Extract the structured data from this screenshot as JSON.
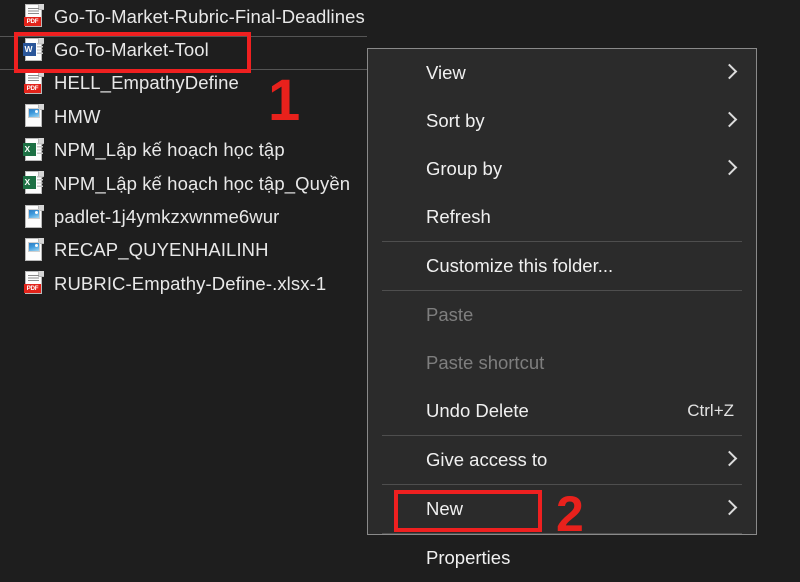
{
  "window": {
    "background_color": "#1e1e1e",
    "menu_background_color": "#2b2b2b",
    "annotation_color": "#e8211c"
  },
  "file_list": {
    "items": [
      {
        "name": "Go-To-Market-Rubric-Final-Deadlines",
        "icon": "pdf-file-icon",
        "type": "pdf"
      },
      {
        "name": "Go-To-Market-Tool",
        "icon": "word-file-icon",
        "type": "word"
      },
      {
        "name": "HELL_EmpathyDefine",
        "icon": "pdf-file-icon",
        "type": "pdf"
      },
      {
        "name": "HMW",
        "icon": "image-file-icon",
        "type": "image"
      },
      {
        "name": "NPM_Lập kế hoạch học tập",
        "icon": "excel-file-icon",
        "type": "excel"
      },
      {
        "name": "NPM_Lập kế hoạch học tập_Quyền",
        "icon": "excel-file-icon",
        "type": "excel"
      },
      {
        "name": "padlet-1j4ymkzxwnme6wur",
        "icon": "image-file-icon",
        "type": "image"
      },
      {
        "name": "RECAP_QUYENHAILINH",
        "icon": "image-file-icon",
        "type": "image"
      },
      {
        "name": "RUBRIC-Empathy-Define-.xlsx-1",
        "icon": "pdf-file-icon",
        "type": "pdf"
      }
    ]
  },
  "context_menu": {
    "groups": [
      {
        "items": [
          {
            "label": "View",
            "submenu": true,
            "disabled": false,
            "accel": ""
          },
          {
            "label": "Sort by",
            "submenu": true,
            "disabled": false,
            "accel": ""
          },
          {
            "label": "Group by",
            "submenu": true,
            "disabled": false,
            "accel": ""
          },
          {
            "label": "Refresh",
            "submenu": false,
            "disabled": false,
            "accel": ""
          }
        ]
      },
      {
        "items": [
          {
            "label": "Customize this folder...",
            "submenu": false,
            "disabled": false,
            "accel": ""
          }
        ]
      },
      {
        "items": [
          {
            "label": "Paste",
            "submenu": false,
            "disabled": true,
            "accel": ""
          },
          {
            "label": "Paste shortcut",
            "submenu": false,
            "disabled": true,
            "accel": ""
          },
          {
            "label": "Undo Delete",
            "submenu": false,
            "disabled": false,
            "accel": "Ctrl+Z"
          }
        ]
      },
      {
        "items": [
          {
            "label": "Give access to",
            "submenu": true,
            "disabled": false,
            "accel": ""
          }
        ]
      },
      {
        "items": [
          {
            "label": "New",
            "submenu": true,
            "disabled": false,
            "accel": ""
          }
        ]
      },
      {
        "items": [
          {
            "label": "Properties",
            "submenu": false,
            "disabled": false,
            "accel": ""
          }
        ]
      }
    ]
  },
  "annotations": {
    "step_one": "1",
    "step_two": "2"
  },
  "icon_badges": {
    "pdf": "PDF",
    "word": "W",
    "excel": "X"
  }
}
